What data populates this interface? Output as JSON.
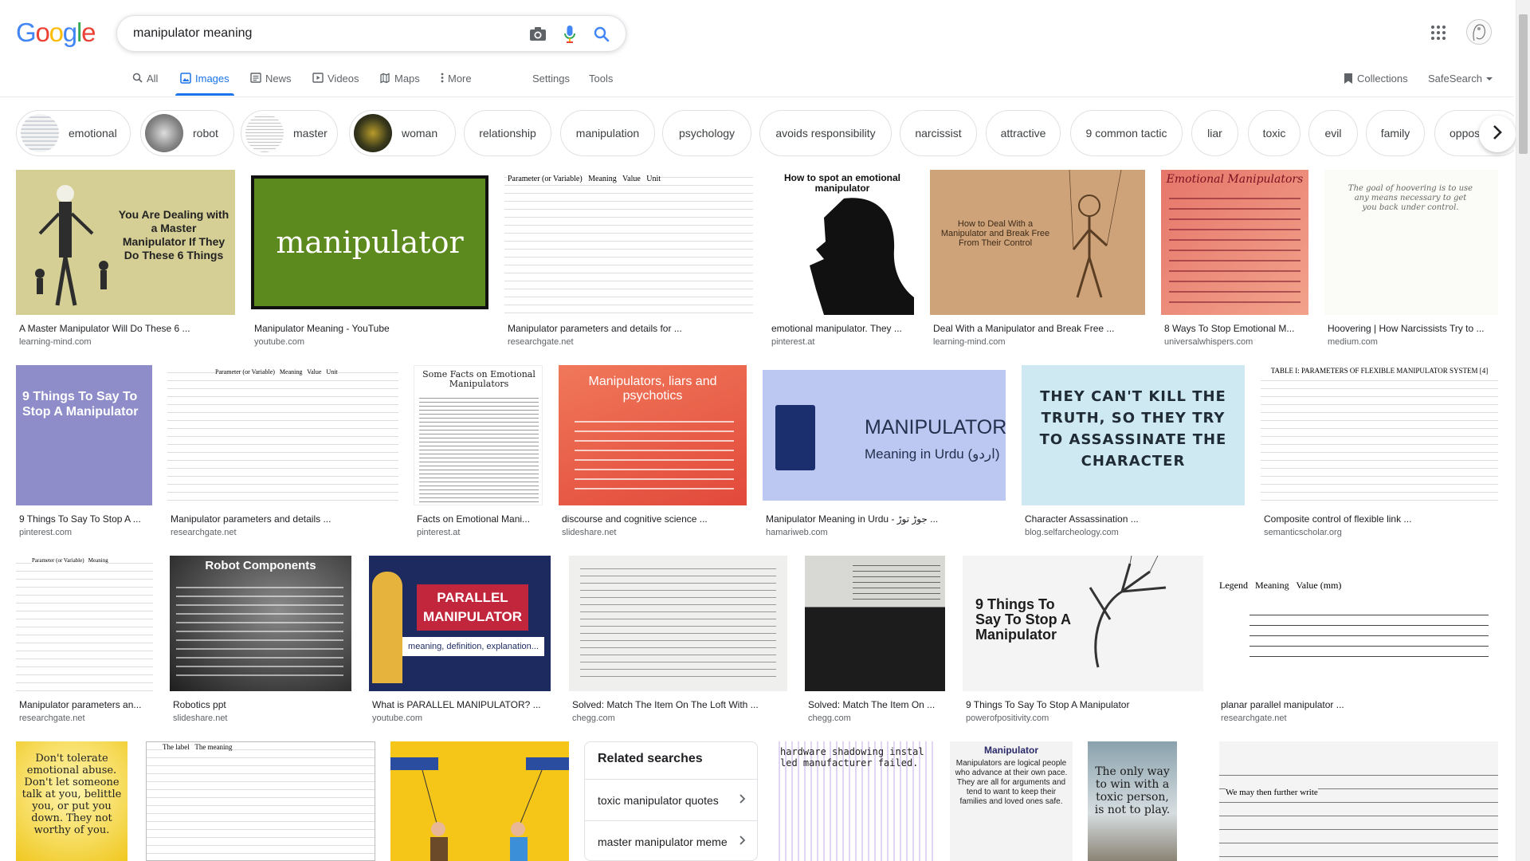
{
  "header": {
    "logo": [
      "G",
      "o",
      "o",
      "g",
      "l",
      "e"
    ],
    "logo_colors": [
      "#4285F4",
      "#EA4335",
      "#FBBC05",
      "#4285F4",
      "#34A853",
      "#EA4335"
    ],
    "query": "manipulator meaning"
  },
  "tabs": {
    "all": "All",
    "images": "Images",
    "news": "News",
    "videos": "Videos",
    "maps": "Maps",
    "more": "More",
    "settings": "Settings",
    "tools": "Tools",
    "collections": "Collections",
    "safesearch": "SafeSearch"
  },
  "chips": [
    "emotional",
    "robot",
    "master",
    "woman",
    "relationship",
    "manipulation",
    "psychology",
    "avoids responsibility",
    "narcissist",
    "attractive",
    "9 common tactic",
    "liar",
    "toxic",
    "evil",
    "family",
    "opposit"
  ],
  "results": [
    {
      "caption": "A Master Manipulator Will Do These 6 ...",
      "source": "learning-mind.com",
      "overlay": "You Are Dealing with a Master Manipulator If They Do These 6 Things"
    },
    {
      "caption": "Manipulator Meaning - YouTube",
      "source": "youtube.com",
      "overlay": "manipulator"
    },
    {
      "caption": "Manipulator parameters and details for ...",
      "source": "researchgate.net",
      "overlay": "Parameter (or Variable)   Meaning   Value   Unit"
    },
    {
      "caption": "emotional manipulator. They ...",
      "source": "pinterest.at",
      "overlay": "How to spot an emotional manipulator"
    },
    {
      "caption": "Deal With a Manipulator and Break Free ...",
      "source": "learning-mind.com",
      "overlay": "How to Deal With a Manipulator and Break Free From Their Control"
    },
    {
      "caption": "8 Ways To Stop Emotional M...",
      "source": "universalwhispers.com",
      "overlay": "Emotional Manipulators"
    },
    {
      "caption": "Hoovering | How Narcissists Try to ...",
      "source": "medium.com",
      "overlay": "The goal of hoovering is to use any means necessary to get you back under control."
    },
    {
      "caption": "9 Things To Say To Stop A ...",
      "source": "pinterest.com",
      "overlay": "9 Things To Say To Stop A Manipulator"
    },
    {
      "caption": "Manipulator parameters and details ...",
      "source": "researchgate.net",
      "overlay": "Parameter (or Variable)   Meaning   Value   Unit"
    },
    {
      "caption": "Facts on Emotional Mani...",
      "source": "pinterest.at",
      "overlay": "Some Facts on Emotional Manipulators"
    },
    {
      "caption": "discourse and cognitive science ...",
      "source": "slideshare.net",
      "overlay": "Manipulators, liars and psychotics"
    },
    {
      "caption": "Manipulator Meaning in Urdu - جوڑ توڑ ...",
      "source": "hamariweb.com",
      "overlay": "MANIPULATOR",
      "overlay2": "Meaning in Urdu (اردو)"
    },
    {
      "caption": "Character Assassination ...",
      "source": "blog.selfarcheology.com",
      "overlay": "THEY CAN'T KILL THE TRUTH, SO THEY TRY TO ASSASSINATE THE CHARACTER"
    },
    {
      "caption": "Composite control of flexible link ...",
      "source": "semanticscholar.org",
      "overlay": "TABLE I: PARAMETERS OF FLEXIBLE MANIPULATOR SYSTEM [4]"
    },
    {
      "caption": "Manipulator parameters an...",
      "source": "researchgate.net",
      "overlay": "Parameter (or Variable)   Meaning"
    },
    {
      "caption": "Robotics ppt",
      "source": "slideshare.net",
      "overlay": "Robot Components"
    },
    {
      "caption": "What is PARALLEL MANIPULATOR? ...",
      "source": "youtube.com",
      "overlay": "PARALLEL MANIPULATOR",
      "overlay2": "meaning, definition, explanation..."
    },
    {
      "caption": "Solved: Match The Item On The Loft With ...",
      "source": "chegg.com",
      "overlay": ""
    },
    {
      "caption": "Solved: Match The Item On ...",
      "source": "chegg.com",
      "overlay": ""
    },
    {
      "caption": "9 Things To Say To Stop A Manipulator",
      "source": "powerofpositivity.com",
      "overlay": "9 Things To Say To Stop A Manipulator"
    },
    {
      "caption": "planar parallel manipulator ...",
      "source": "researchgate.net",
      "overlay": "Legend   Meaning   Value (mm)"
    },
    {
      "caption": "",
      "source": "",
      "overlay": "Don't tolerate emotional abuse. Don't let someone talk at you, belittle you, or put you down. They not worthy of you."
    },
    {
      "caption": "",
      "source": "",
      "overlay": "The label   The meaning"
    },
    {
      "caption": "",
      "source": "",
      "overlay": ""
    },
    {
      "caption": "",
      "source": "",
      "overlay": "hardware shadowing  installed manufacturer  failed."
    },
    {
      "caption": "",
      "source": "",
      "overlay": "Manipulator",
      "overlay2": "Manipulators are logical people who advance at their own pace. They are all for arguments and tend to want to keep their families and loved ones safe."
    },
    {
      "caption": "",
      "source": "",
      "overlay": "The only way to win with a toxic person, is not to play."
    },
    {
      "caption": "",
      "source": "",
      "overlay": "We may then further write"
    }
  ],
  "related": {
    "title": "Related searches",
    "items": [
      "toxic manipulator quotes",
      "master manipulator meme"
    ]
  }
}
